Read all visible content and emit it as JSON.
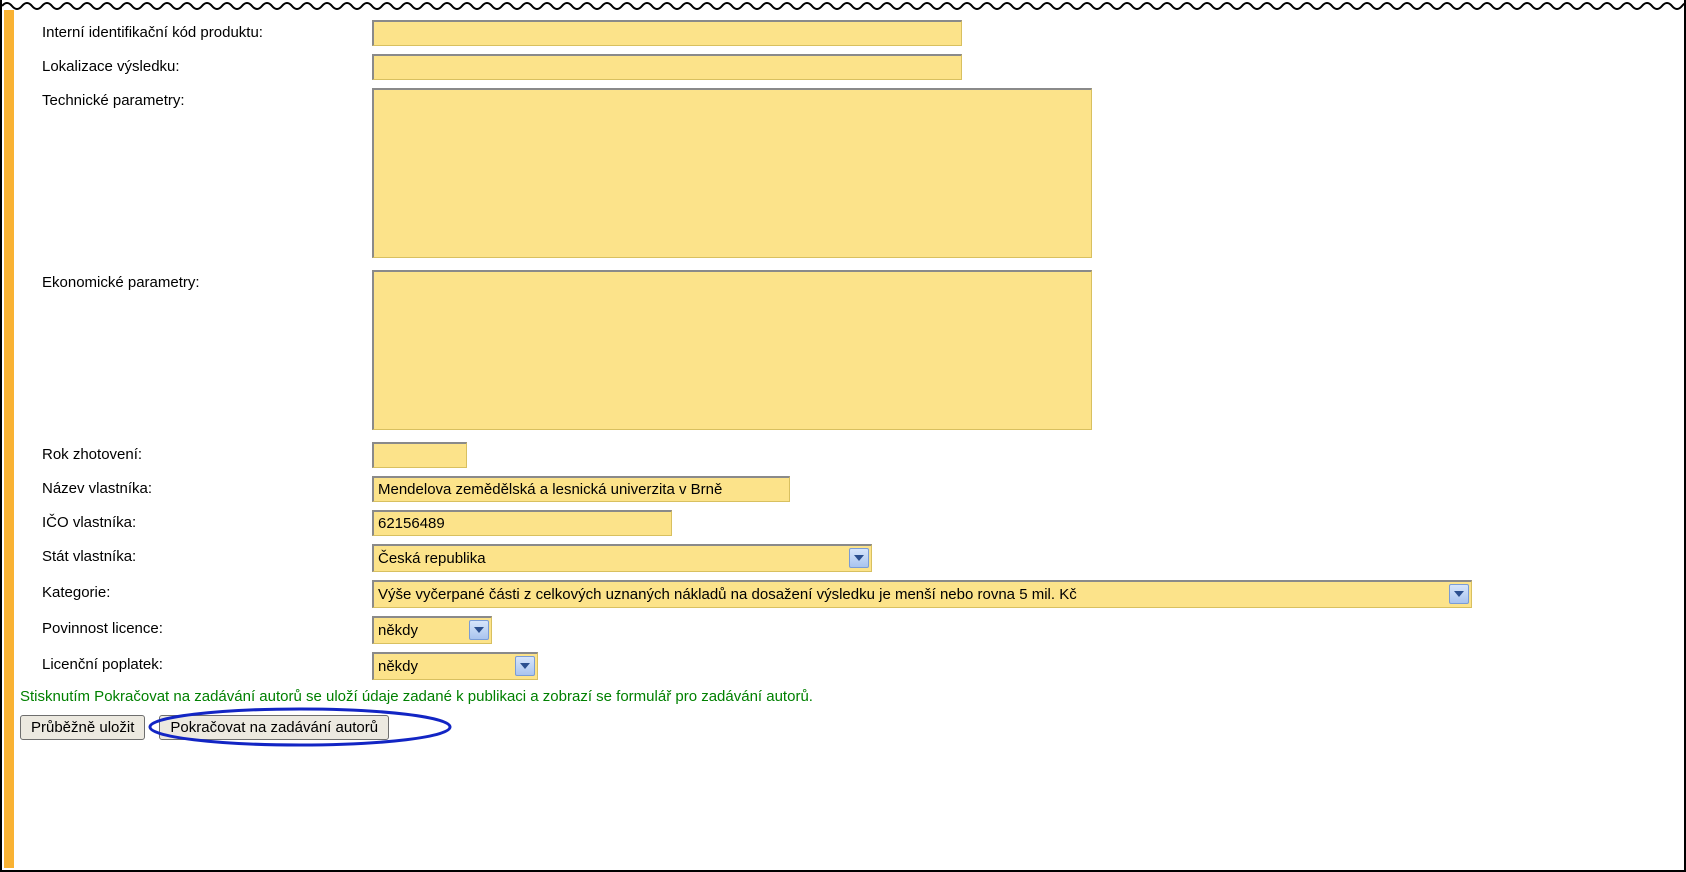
{
  "labels": {
    "internal_code": "Interní identifikační kód produktu:",
    "localization": "Lokalizace výsledku:",
    "tech_params": "Technické parametry:",
    "econ_params": "Ekonomické parametry:",
    "year": "Rok zhotovení:",
    "owner_name": "Název vlastníka:",
    "owner_ico": "IČO vlastníka:",
    "owner_state": "Stát vlastníka:",
    "category": "Kategorie:",
    "license_duty": "Povinnost licence:",
    "license_fee": "Licenční poplatek:"
  },
  "values": {
    "internal_code": "",
    "localization": "",
    "tech_params": "",
    "econ_params": "",
    "year": "",
    "owner_name": "Mendelova zemědělská a lesnická univerzita v Brně",
    "owner_ico": "62156489",
    "owner_state": "Česká republika",
    "category": "Výše vyčerpané části z celkových uznaných nákladů na dosažení výsledku je menší nebo rovna 5 mil. Kč",
    "license_duty": "někdy",
    "license_fee": "někdy"
  },
  "hint": "Stisknutím Pokračovat na zadávání autorů se uloží údaje zadané k publikaci a zobrazí se formulář pro zadávání autorů.",
  "buttons": {
    "save": "Průběžně uložit",
    "continue": "Pokračovat na zadávání autorů"
  }
}
